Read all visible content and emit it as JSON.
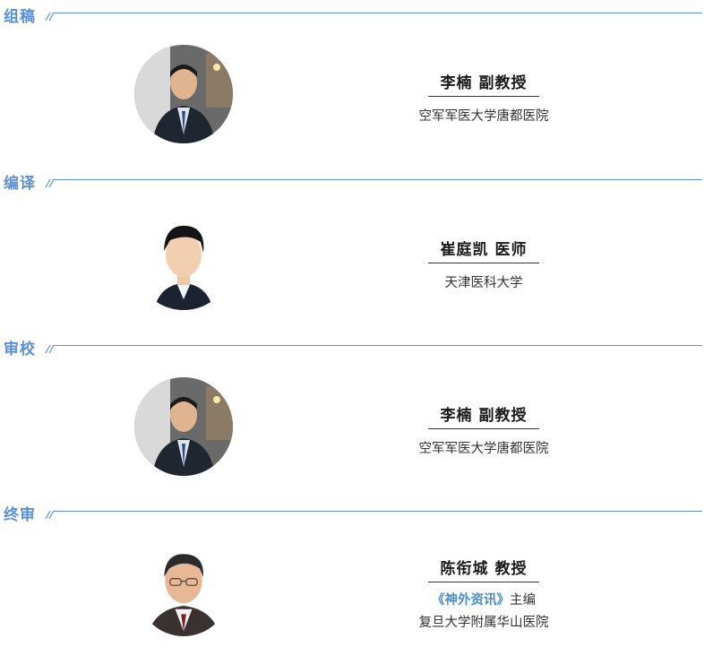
{
  "sections": [
    {
      "title": "组稿",
      "person": {
        "name": "李楠 副教授",
        "affiliation": "空军军医大学唐都医院",
        "photo_icon": "portrait-photo"
      }
    },
    {
      "title": "编译",
      "person": {
        "name": "崔庭凯 医师",
        "affiliation": "天津医科大学",
        "photo_icon": "portrait-photo"
      }
    },
    {
      "title": "审校",
      "person": {
        "name": "李楠 副教授",
        "affiliation": "空军军医大学唐都医院",
        "photo_icon": "portrait-photo"
      }
    },
    {
      "title": "终审",
      "person": {
        "name": "陈衔城 教授",
        "journal": "《神外资讯》",
        "role": "主编",
        "affiliation": "复旦大学附属华山医院",
        "photo_icon": "portrait-photo"
      }
    }
  ],
  "colors": {
    "accent": "#5b8fd6",
    "journal": "#4a8ecb",
    "text": "#1b1b1b"
  }
}
